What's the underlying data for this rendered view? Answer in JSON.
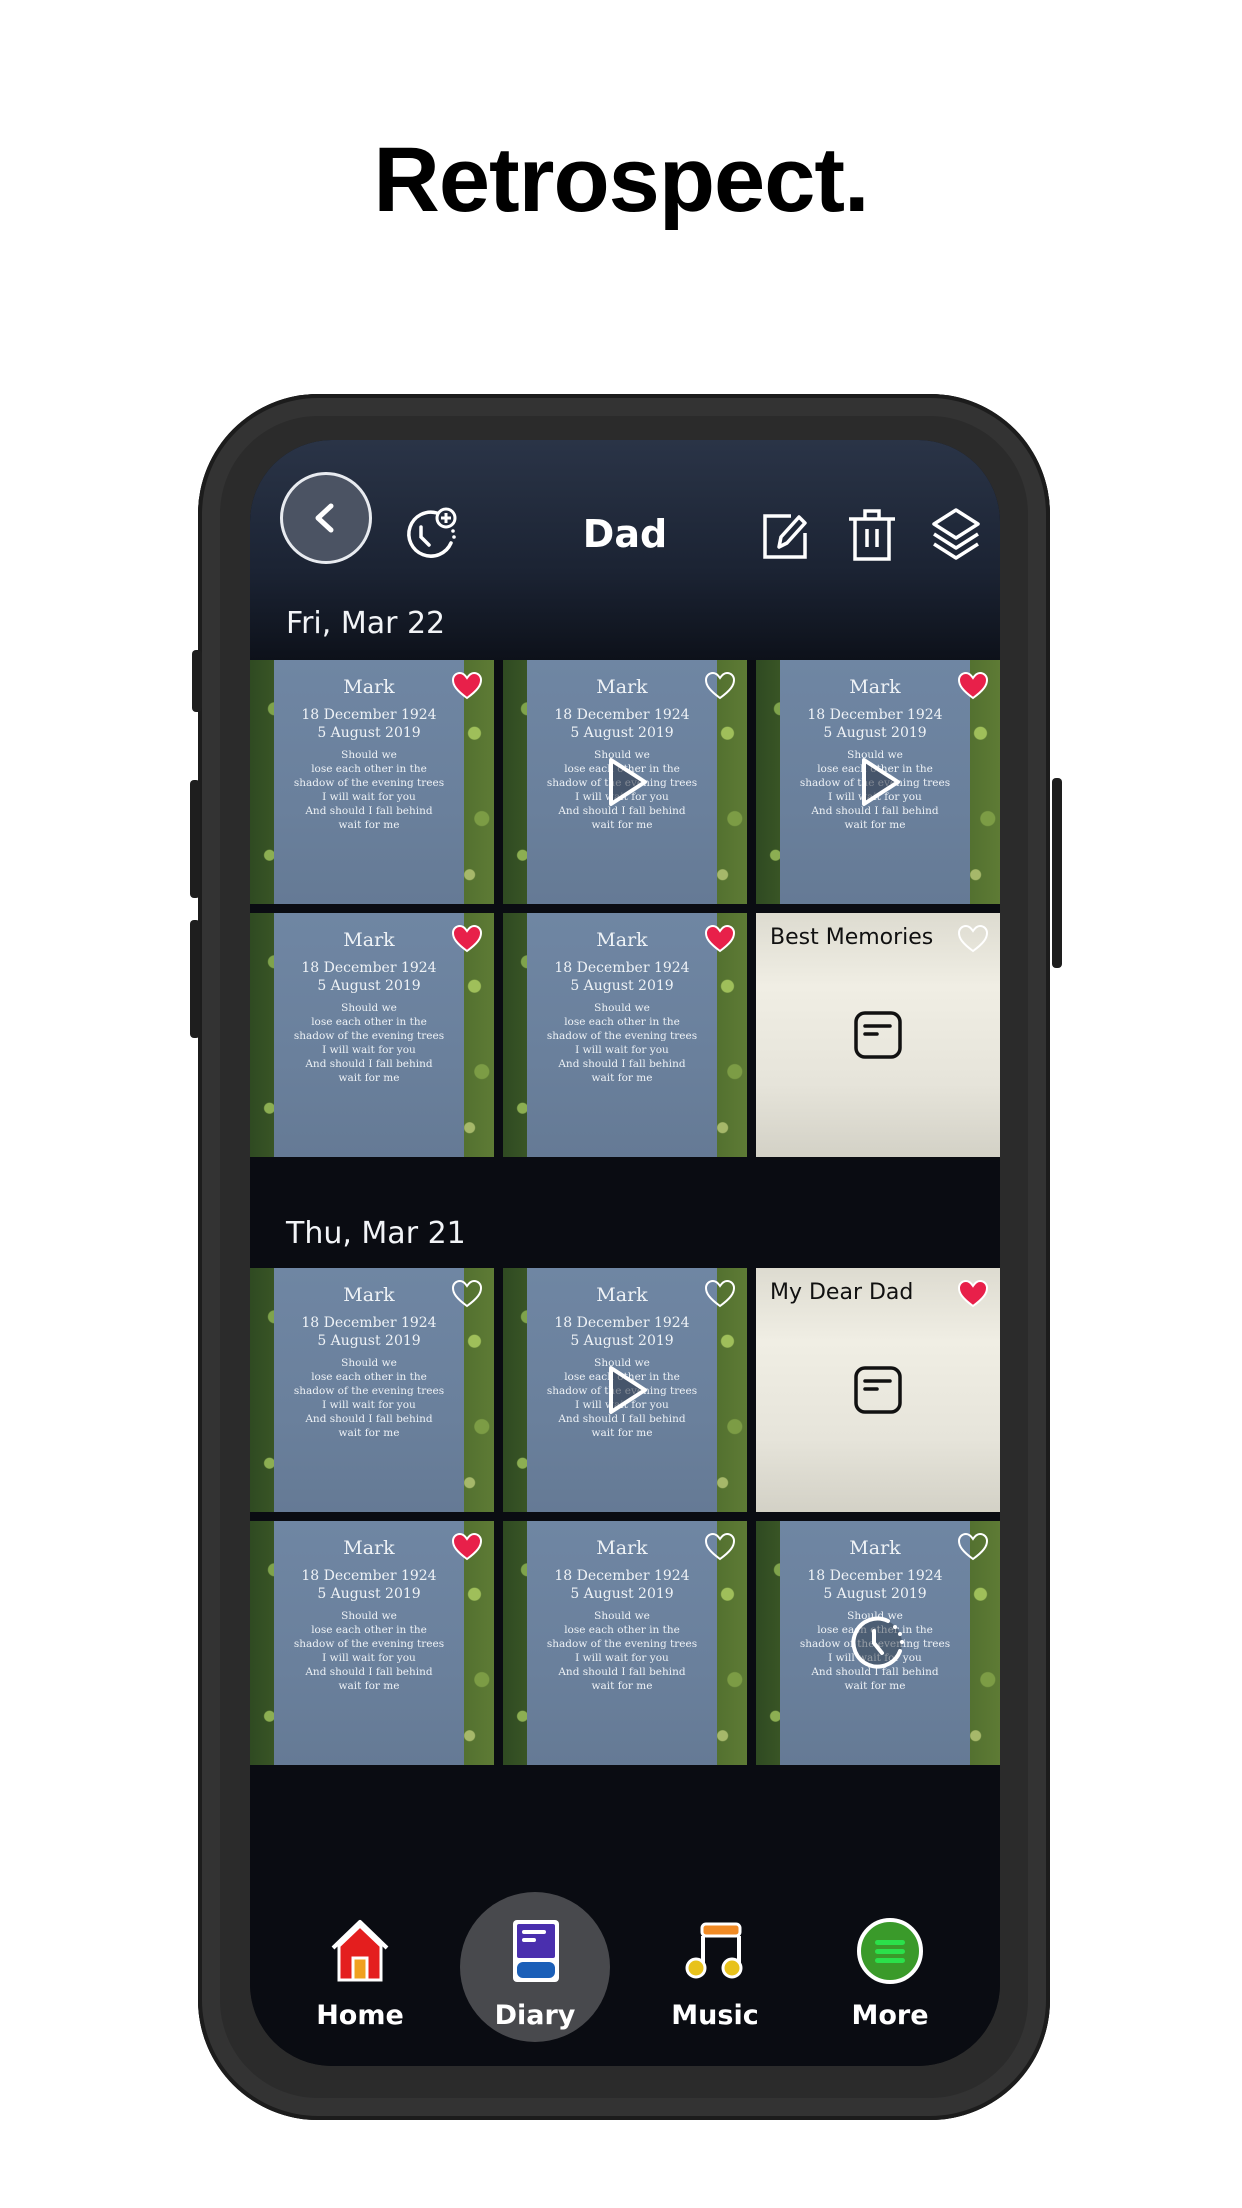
{
  "headline": "Retrospect.",
  "header": {
    "title": "Dad",
    "icons": [
      "back-chevron-icon",
      "add-reminder-clock-icon",
      "edit-icon",
      "trash-icon",
      "layers-icon"
    ]
  },
  "sections": [
    {
      "date": "Fri, Mar 22",
      "items": [
        {
          "type": "photo",
          "favorite": true,
          "overlay": "none"
        },
        {
          "type": "video",
          "favorite": false,
          "overlay": "play"
        },
        {
          "type": "video",
          "favorite": true,
          "overlay": "play"
        },
        {
          "type": "photo",
          "favorite": true,
          "overlay": "none"
        },
        {
          "type": "photo",
          "favorite": true,
          "overlay": "none"
        },
        {
          "type": "note",
          "title": "Best Memories",
          "favorite": false
        }
      ]
    },
    {
      "date": "Thu, Mar 21",
      "items": [
        {
          "type": "photo",
          "favorite": false,
          "overlay": "none"
        },
        {
          "type": "video",
          "favorite": false,
          "overlay": "play"
        },
        {
          "type": "note",
          "title": "My Dear Dad",
          "favorite": true
        },
        {
          "type": "photo",
          "favorite": true,
          "overlay": "none"
        },
        {
          "type": "photo",
          "favorite": false,
          "overlay": "none"
        },
        {
          "type": "timed",
          "favorite": false,
          "overlay": "clock"
        }
      ]
    }
  ],
  "photo_content": {
    "name": "Mark",
    "born": "18 December 1924",
    "died": "5 August 2019",
    "verse": [
      "Should we",
      "lose each other in the",
      "shadow of the evening trees",
      "I will wait for you",
      "And should I fall behind",
      "wait for me"
    ]
  },
  "nav": {
    "items": [
      {
        "label": "Home",
        "icon": "home-icon",
        "active": false
      },
      {
        "label": "Diary",
        "icon": "diary-book-icon",
        "active": true
      },
      {
        "label": "Music",
        "icon": "music-note-icon",
        "active": false
      },
      {
        "label": "More",
        "icon": "more-menu-icon",
        "active": false
      }
    ]
  },
  "colors": {
    "heart_active": "#e8204a",
    "home_red": "#e41e1e",
    "diary_purple": "#4a2fae",
    "diary_blue": "#1b5fb8",
    "music_orange": "#f08a24",
    "music_yellow": "#e8c21c",
    "more_green": "#3a9a2a"
  }
}
